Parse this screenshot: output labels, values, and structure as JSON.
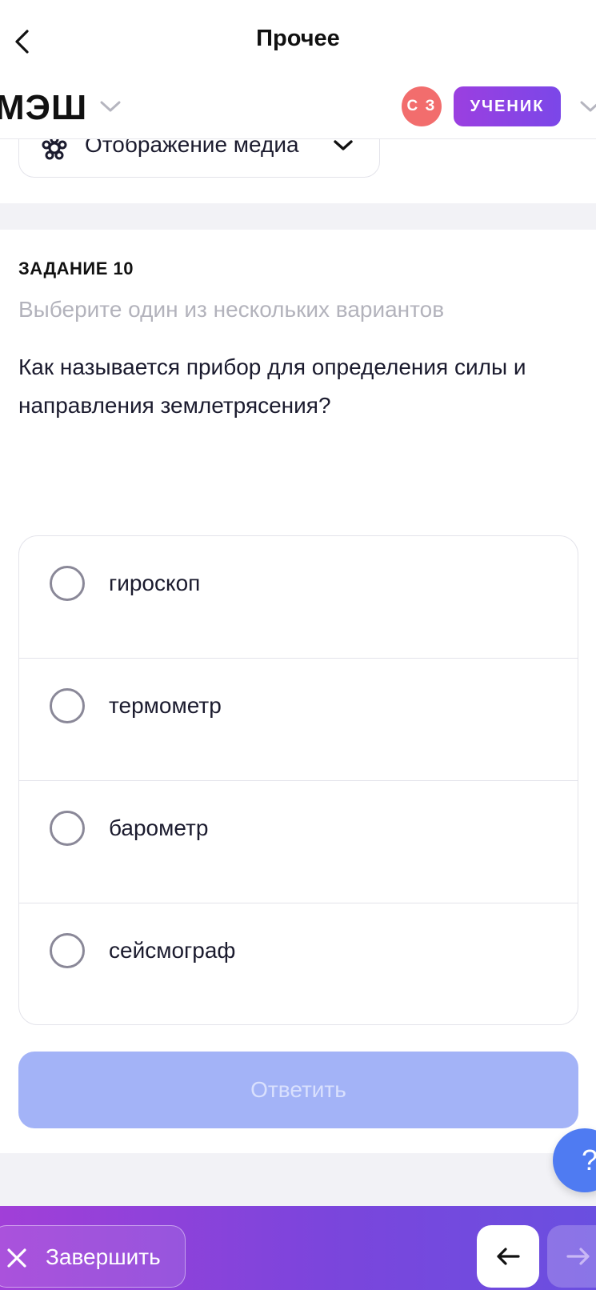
{
  "navbar": {
    "title": "Прочее"
  },
  "header": {
    "logo": "МЭШ",
    "avatar_initials": "С З",
    "role": "УЧЕНИК"
  },
  "media": {
    "label": "Отображение медиа"
  },
  "task": {
    "number": "ЗАДАНИЕ 10",
    "hint": "Выберите один из нескольких вариантов",
    "question": "Как называется прибор для определения силы и направления землетрясения?",
    "options": [
      {
        "label": "гироскоп",
        "selected": false
      },
      {
        "label": "термометр",
        "selected": false
      },
      {
        "label": "барометр",
        "selected": false
      },
      {
        "label": "сейсмограф",
        "selected": false
      }
    ],
    "submit_label": "Ответить"
  },
  "help": {
    "label": "?"
  },
  "bottom": {
    "finish_label": "Завершить"
  },
  "colors": {
    "accent_purple": "#9b3fe0",
    "avatar_red": "#f26d6d",
    "submit_disabled": "#a3b3f7",
    "help_blue": "#4f7bf2"
  }
}
